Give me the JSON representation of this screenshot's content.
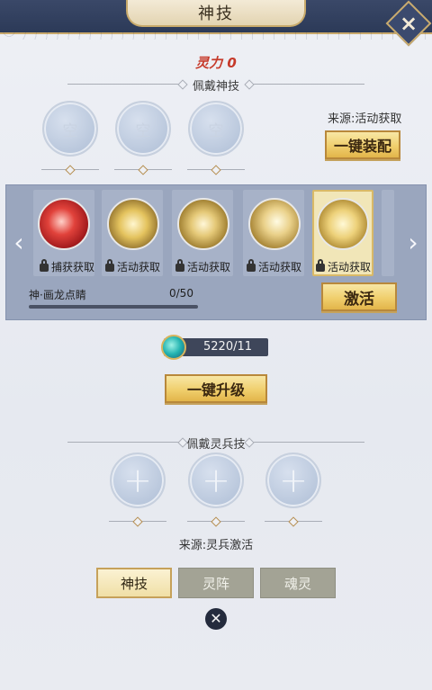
{
  "header": {
    "title": "神技"
  },
  "power": {
    "label": "灵力 0"
  },
  "equip_section": {
    "title": "佩戴神技",
    "slots": [
      "空",
      "空",
      "空"
    ],
    "source": "来源:活动获取",
    "equip_button": "一键装配"
  },
  "skills": [
    {
      "label": "捕获获取",
      "locked": false
    },
    {
      "label": "活动获取",
      "locked": true
    },
    {
      "label": "活动获取",
      "locked": true
    },
    {
      "label": "活动获取",
      "locked": true
    },
    {
      "label": "活动获取",
      "locked": true,
      "selected": true
    }
  ],
  "selected_skill": {
    "name": "神·画龙点睛",
    "progress_text": "0/50",
    "progress": 0,
    "activate_button": "激活"
  },
  "currency": {
    "value": "5220/11"
  },
  "upgrade_button": "一键升级",
  "weapon_section": {
    "title": "佩戴灵兵技",
    "source": "来源:灵兵激活"
  },
  "tabs": [
    {
      "label": "神技",
      "active": true
    },
    {
      "label": "灵阵",
      "active": false
    },
    {
      "label": "魂灵",
      "active": false
    }
  ],
  "colors": {
    "accent_gold": "#f0cf6d",
    "power_red": "#c63a2a",
    "header_navy": "#2c3a58"
  }
}
